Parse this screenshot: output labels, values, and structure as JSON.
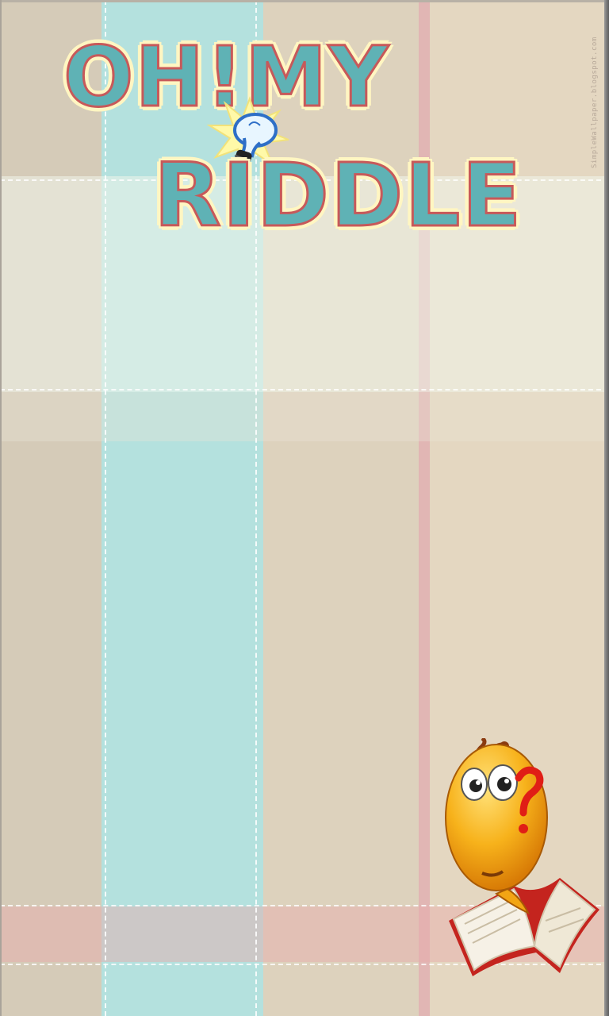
{
  "title": {
    "line1": "OH!MY",
    "line2": "RIDDLE"
  },
  "watermark": "SimpleWallpaper.blogspot.com",
  "icons": {
    "bulb": "lightbulb-icon",
    "mascot": "thinking-emoticon-with-book"
  },
  "colors": {
    "title_fill": "#5fb2b5",
    "title_outline": "#c7595a",
    "title_glow": "#fff6c2",
    "teal_stripe": "#b4e1de",
    "pink_stripe": "#e2b2b2",
    "beige": "#ddd2bd"
  }
}
